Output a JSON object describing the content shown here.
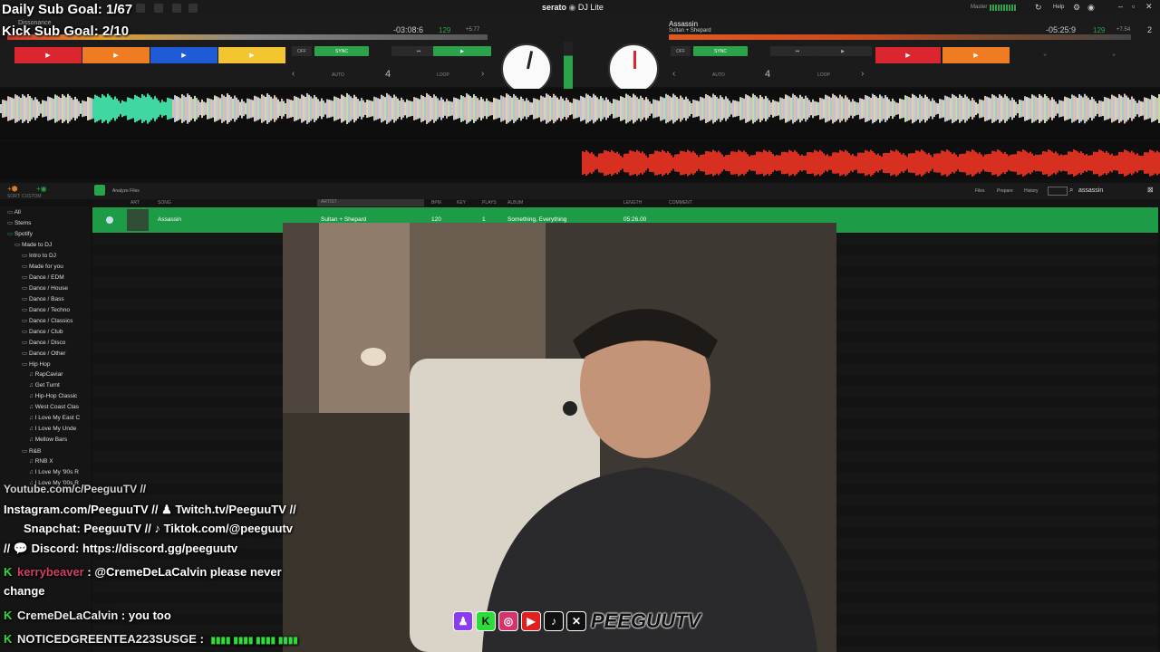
{
  "app": {
    "brand": "serato",
    "product": "DJ Lite"
  },
  "overlay": {
    "goal_daily": "Daily Sub Goal: 1/67",
    "goal_kick": "Kick Sub Goal: 2/10"
  },
  "deckA": {
    "title": "Dissonance",
    "time": "-03:08:6",
    "bpm": "129",
    "pitch": "+5.77",
    "sync_off": "OFF",
    "sync": "SYNC",
    "auto": "AUTO",
    "loop_len": "4",
    "loop": "LOOP",
    "hotcues": [
      "▶",
      "▶",
      "▶",
      "▶"
    ],
    "hotcue_colors": [
      "#d9262f",
      "#ef7b22",
      "#1f5bd6",
      "#f2c531"
    ]
  },
  "deckB": {
    "title": "Assassin",
    "artist": "Sultan + Shepard",
    "time": "-05:25:9",
    "bpm": "129",
    "pitch": "+7.54",
    "sync_off": "OFF",
    "sync": "SYNC",
    "auto": "AUTO",
    "loop_len": "4",
    "loop": "LOOP",
    "hotcues": [
      "▶",
      "▶",
      "+",
      "+"
    ],
    "hotcue_colors": [
      "#d9262f",
      "#ef7b22",
      "#1b1b1b",
      "#1b1b1b"
    ]
  },
  "topmenu": {
    "master": "Master",
    "help": "Help",
    "deck_count": "2"
  },
  "library": {
    "sort_label": "SORT: CUSTOM",
    "analyze_label": "Analyze Files",
    "search_value": "assassin",
    "right_tabs": [
      "Files",
      "Prepare",
      "History"
    ],
    "columns": [
      "ART",
      "SONG",
      "ARTIST",
      "BPM",
      "KEY",
      "PLAYS",
      "ALBUM",
      "LENGTH",
      "COMMENT"
    ],
    "track": {
      "song": "Assassin",
      "artist": "Sultan + Shepard",
      "bpm": "120",
      "plays": "1",
      "album": "Something, Everything",
      "length": "05:26.00"
    },
    "sidebar": [
      "All",
      "Stems",
      "Spotify",
      "Made to DJ",
      "Intro to DJ",
      "Made for you",
      "Dance / EDM",
      "Dance / House",
      "Dance / Bass",
      "Dance / Techno",
      "Dance / Classics",
      "Dance / Club",
      "Dance / Disco",
      "Dance / Other",
      "Hip Hop",
      "RapCaviar",
      "Get Turnt",
      "Hip-Hop Classic",
      "West Coast Clas",
      "I Love My East C",
      "I Love My Unde",
      "Mellow Bars",
      "R&B",
      "RNB X",
      "I Love My '90s R",
      "I Love My '00s R"
    ]
  },
  "chat": {
    "line_partial": "Youtube.com/c/PeeguuTV //",
    "line1": "Instagram.com/PeeguuTV // ♟ Twitch.tv/PeeguuTV //",
    "line2": "Snapchat: PeeguuTV // ♪ Tiktok.com/@peeguutv",
    "line3": "// 💬 Discord: https://discord.gg/peeguutv",
    "msg1_user": "kerrybeaver",
    "msg1_text": ": @CremeDeLaCalvin please never",
    "msg1_cont": "change",
    "msg2_user": "CremeDeLaCalvin",
    "msg2_text": ": you too",
    "msg3_user": "NOTICEDGREENTEA223SUSGE",
    "msg3_text": ":"
  },
  "socials": {
    "brand": "PEEGUUTV"
  }
}
